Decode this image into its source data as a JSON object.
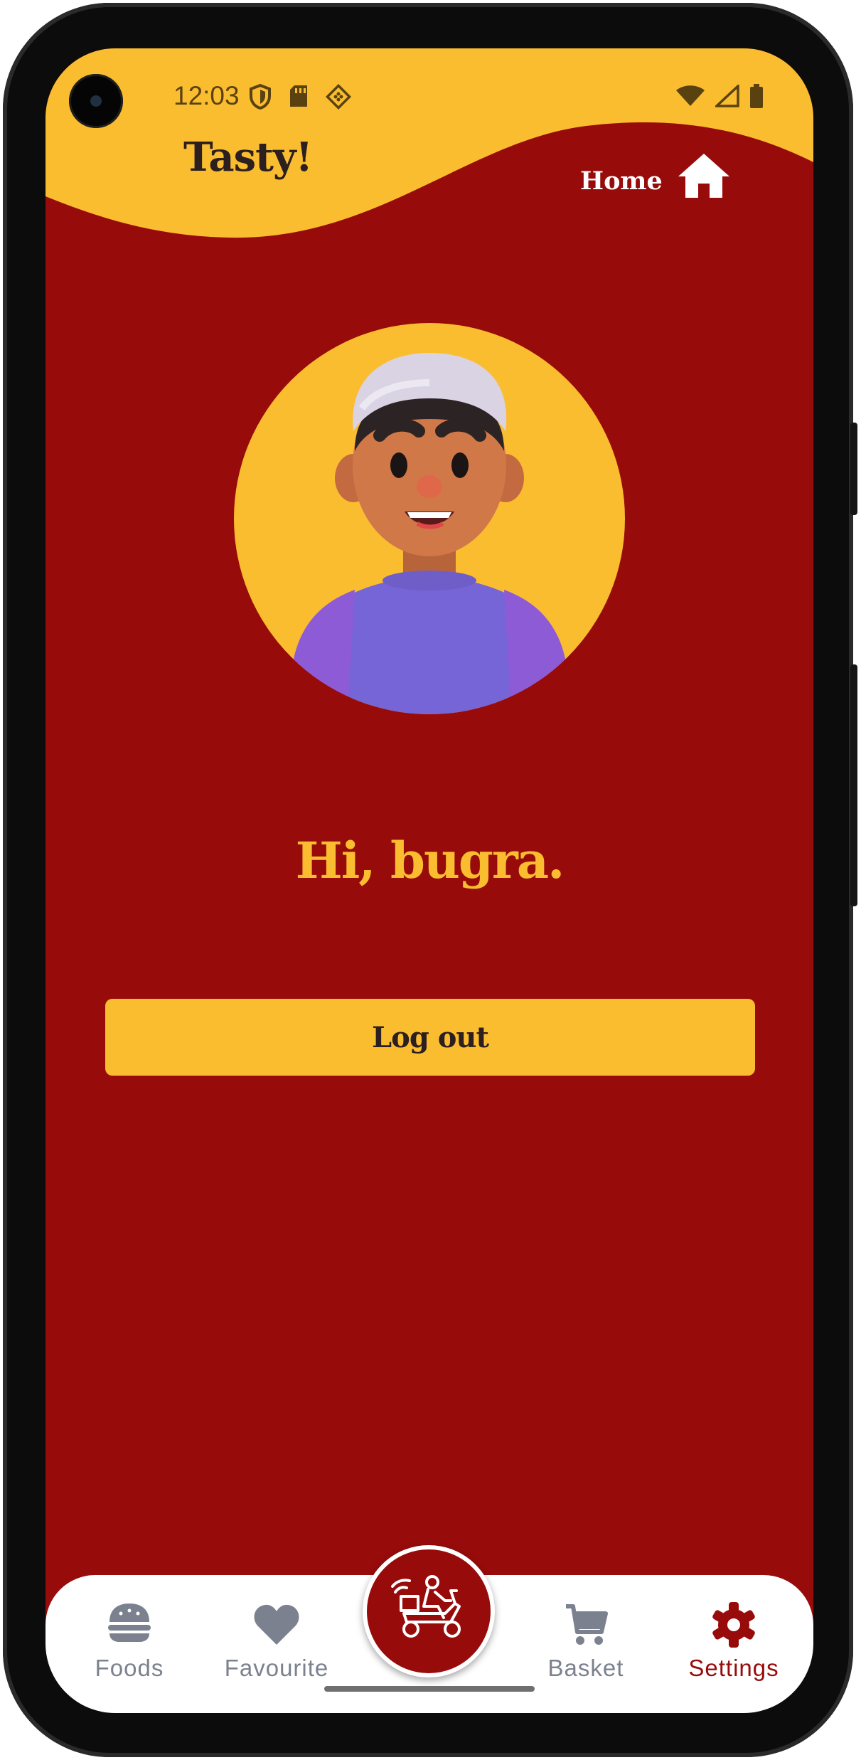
{
  "status_bar": {
    "time": "12:03",
    "left_icons": [
      "shield-icon",
      "sd-card-icon",
      "app-notification-icon"
    ],
    "right_icons": [
      "wifi-icon",
      "cell-signal-icon",
      "battery-icon"
    ]
  },
  "header": {
    "app_title": "Tasty!",
    "home_label": "Home",
    "home_icon": "home-icon"
  },
  "profile": {
    "avatar": "user-avatar-3d",
    "greeting": "Hi, bugra."
  },
  "actions": {
    "logout_label": "Log out"
  },
  "bottom_nav": {
    "items": [
      {
        "label": "Foods",
        "icon": "burger-icon"
      },
      {
        "label": "Favourite",
        "icon": "heart-icon"
      },
      {
        "label": "Basket",
        "icon": "cart-icon"
      },
      {
        "label": "Settings",
        "icon": "gear-icon"
      }
    ],
    "active": "Settings",
    "center_button_icon": "delivery-scooter-icon"
  },
  "colors": {
    "primary": "#980b0b",
    "accent": "#fbbd30",
    "nav_inactive": "#7b818e",
    "title_dark": "#2b1f1f"
  }
}
